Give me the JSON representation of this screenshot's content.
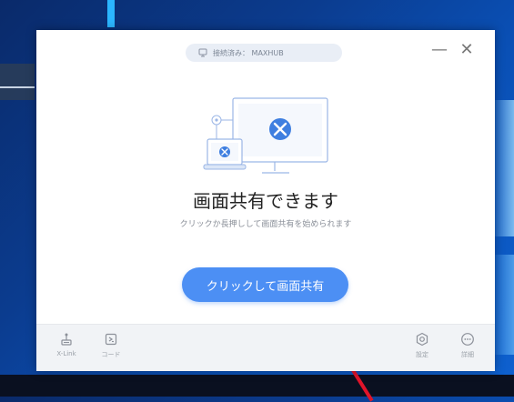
{
  "window": {
    "status_text": "接続済み： MAXHUB",
    "minimize_glyph": "—",
    "close_glyph": "✕"
  },
  "main": {
    "title": "画面共有できます",
    "subtitle": "クリックか長押しして画面共有を始められます",
    "share_button": "クリックして画面共有"
  },
  "footer": {
    "left": [
      {
        "icon": "xlink-icon",
        "label": "X-Link"
      },
      {
        "icon": "code-icon",
        "label": "コード"
      }
    ],
    "right": [
      {
        "icon": "settings-icon",
        "label": "設定"
      },
      {
        "icon": "more-icon",
        "label": "詳細"
      }
    ]
  },
  "colors": {
    "accent": "#4c8ff4",
    "desktop": "#0b3c8f",
    "footer_bg": "#f1f3f6"
  }
}
